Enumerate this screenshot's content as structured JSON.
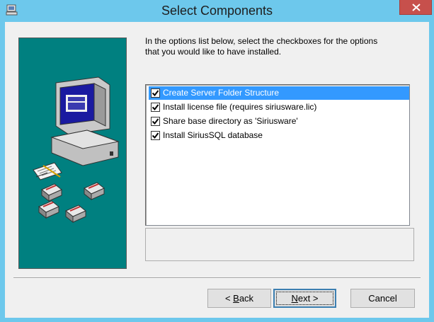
{
  "window": {
    "title": "Select Components",
    "close_glyph": "close-icon"
  },
  "instructions": {
    "line1": "In the options list below, select the checkboxes for the options",
    "line2": "that you would like to have installed."
  },
  "components": [
    {
      "label": "Create Server Folder Structure",
      "checked": true,
      "selected": true
    },
    {
      "label": "Install license file (requires siriusware.lic)",
      "checked": true,
      "selected": false
    },
    {
      "label": "Share base directory as 'Siriusware'",
      "checked": true,
      "selected": false
    },
    {
      "label": "Install SiriusSQL database",
      "checked": true,
      "selected": false
    }
  ],
  "buttons": {
    "back": {
      "prefix": "< ",
      "accel": "B",
      "rest": "ack"
    },
    "next": {
      "accel": "N",
      "rest": "ext >"
    },
    "cancel": "Cancel"
  },
  "colors": {
    "titlebar": "#6dc8ec",
    "close": "#c7504c",
    "art_background": "#008080",
    "selection": "#3399ff"
  }
}
